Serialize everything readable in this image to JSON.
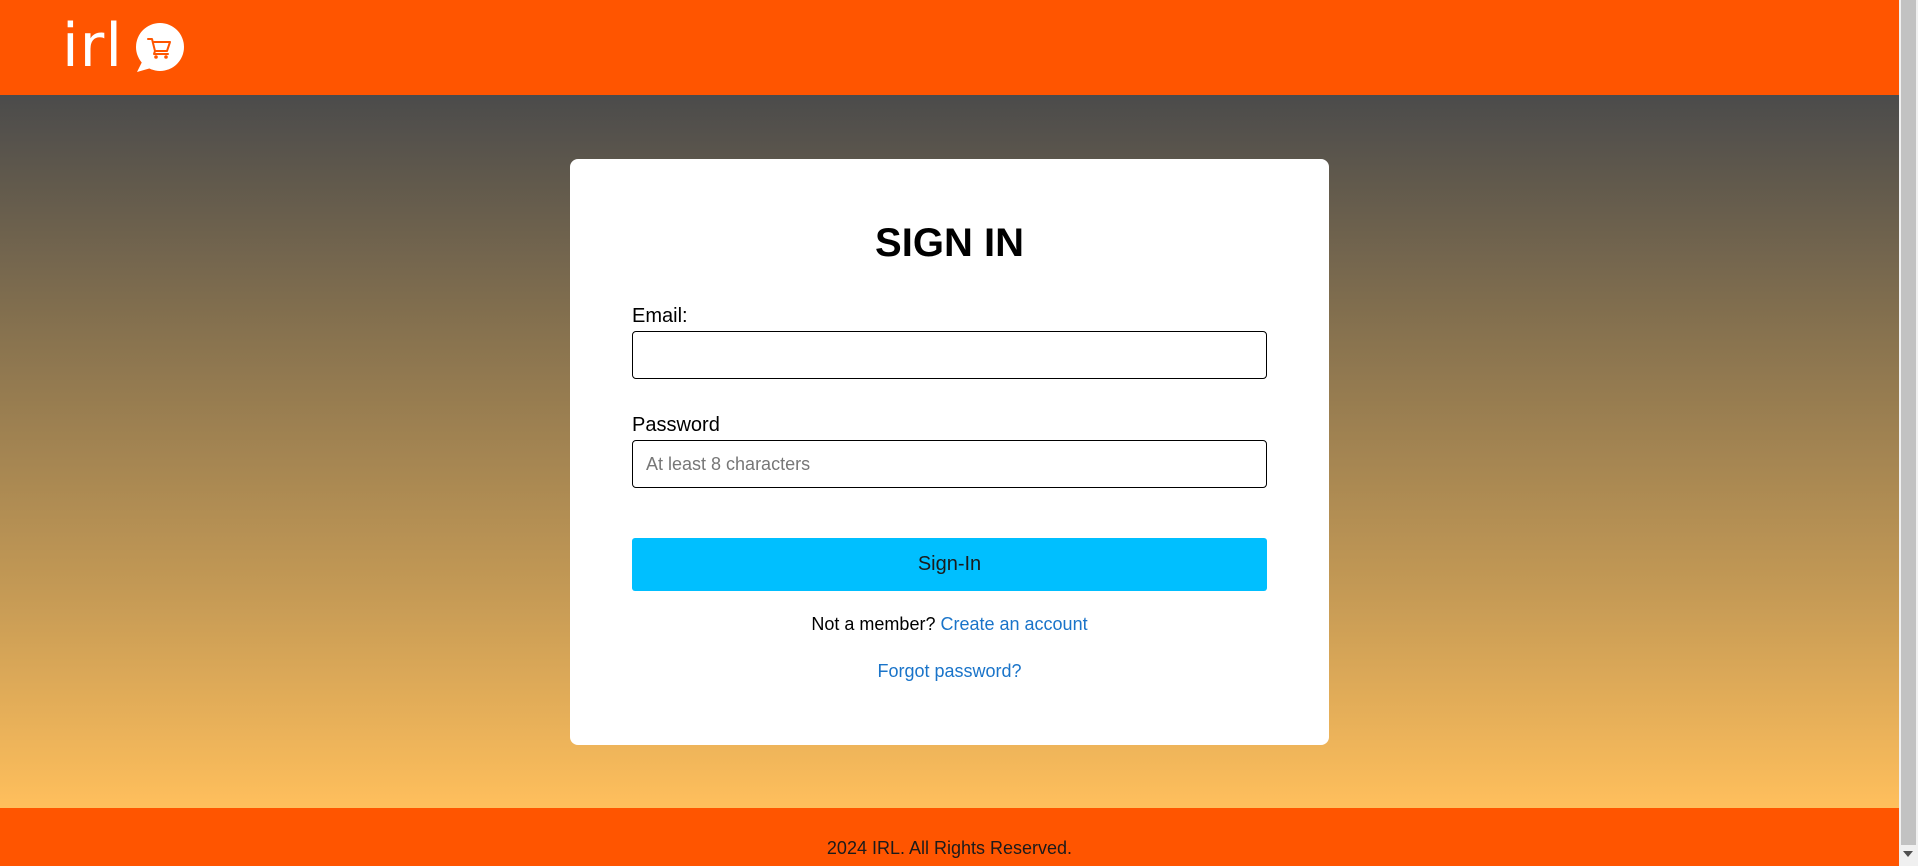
{
  "brand": {
    "logo_text": "irl",
    "logo_icon": "cart-icon",
    "color": "#ff5500"
  },
  "signin": {
    "title": "SIGN IN",
    "email_label": "Email:",
    "email_value": "",
    "password_label": "Password",
    "password_placeholder": "At least 8 characters",
    "submit_label": "Sign-In",
    "member_prompt": "Not a member?",
    "create_account_label": "Create an account",
    "forgot_label": "Forgot password?",
    "button_color": "#00bfff",
    "link_color": "#1a74c9"
  },
  "footer": {
    "copyright": "2024 IRL. All Rights Reserved."
  }
}
